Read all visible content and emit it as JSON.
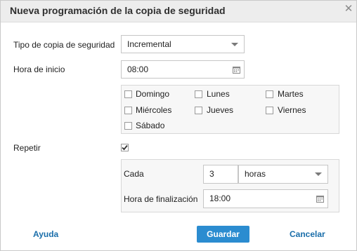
{
  "dialog": {
    "title": "Nueva programación de la copia de seguridad",
    "close_glyph": "✕"
  },
  "backup_type": {
    "label": "Tipo de copia de seguridad",
    "value": "Incremental"
  },
  "start_time": {
    "label": "Hora de inicio",
    "value": "08:00"
  },
  "days": [
    {
      "label": "Domingo",
      "checked": false
    },
    {
      "label": "Lunes",
      "checked": false
    },
    {
      "label": "Martes",
      "checked": false
    },
    {
      "label": "Miércoles",
      "checked": false
    },
    {
      "label": "Jueves",
      "checked": false
    },
    {
      "label": "Viernes",
      "checked": false
    },
    {
      "label": "Sábado",
      "checked": false
    }
  ],
  "repeat": {
    "label": "Repetir",
    "checked": true,
    "every_label": "Cada",
    "every_value": "3",
    "unit_value": "horas",
    "end_label": "Hora de finalización",
    "end_value": "18:00"
  },
  "footer": {
    "help": "Ayuda",
    "save": "Guardar",
    "cancel": "Cancelar"
  },
  "colors": {
    "primary": "#2b8cd0",
    "link": "#1a6eaa",
    "titlebar": "#ededed"
  },
  "icons": {
    "close": "close-icon",
    "calendar": "calendar-icon",
    "dropdown": "chevron-down-icon",
    "check": "check-icon"
  }
}
